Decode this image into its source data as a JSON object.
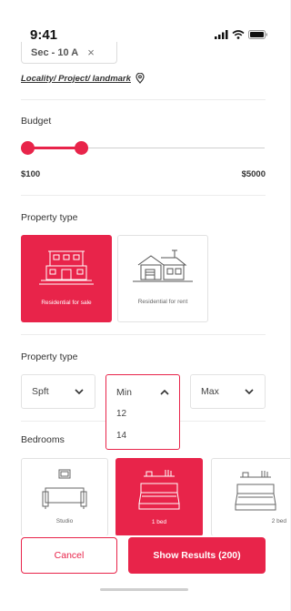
{
  "status_bar": {
    "time": "9:41"
  },
  "location": {
    "chip_label": "Sec - 10 A",
    "chip_remove": "×",
    "locality_link": "Locality/ Project/ landmark"
  },
  "budget": {
    "title": "Budget",
    "min_label": "$100",
    "max_label": "$5000",
    "selected_range_fraction": [
      0,
      0.22
    ]
  },
  "property_type": {
    "title": "Property type",
    "options": [
      {
        "label": "Residential for sale",
        "selected": true
      },
      {
        "label": "Residential for rent",
        "selected": false
      }
    ]
  },
  "area": {
    "title": "Property type",
    "unit_value": "Spft",
    "min_value": "Min",
    "max_value": "Max",
    "min_options": [
      "12",
      "14"
    ]
  },
  "bedrooms": {
    "title": "Bedrooms",
    "options": [
      {
        "label": "Studio",
        "selected": false
      },
      {
        "label": "1 bed",
        "selected": true
      },
      {
        "label": "2 bed",
        "selected": false
      }
    ]
  },
  "actions": {
    "cancel_label": "Cancel",
    "show_results_label": "Show Results (200)"
  },
  "colors": {
    "accent": "#e8244a",
    "border": "#e2e2e2",
    "text": "#333333"
  }
}
